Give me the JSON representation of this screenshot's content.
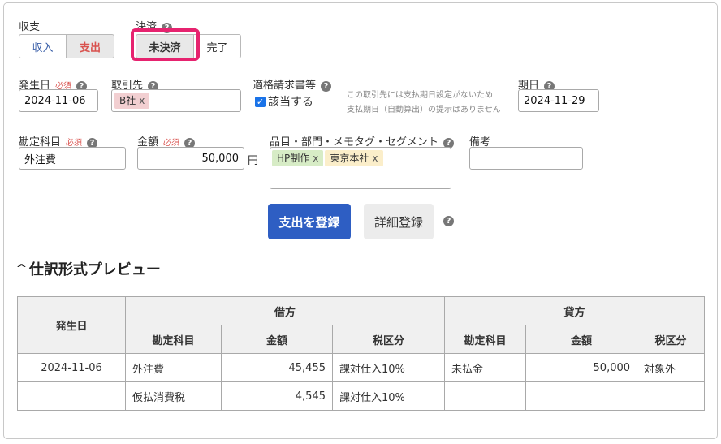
{
  "income_expense": {
    "label": "収支",
    "options": [
      "収入",
      "支出"
    ],
    "selected": "支出",
    "colors": {
      "income": "#3a5fa8",
      "expense": "#d9534f"
    }
  },
  "settlement": {
    "label": "決済",
    "options": [
      "未決済",
      "完了"
    ],
    "selected": "未決済"
  },
  "date": {
    "label": "発生日",
    "required": "必須",
    "value": "2024-11-06"
  },
  "partner": {
    "label": "取引先",
    "tag": "B社",
    "tag_remove": "x",
    "tag_color": "#f2cfd1"
  },
  "invoice": {
    "label": "適格請求書等",
    "checkbox_label": "該当する",
    "checked": true
  },
  "due_note": {
    "line1": "この取引先には支払期日設定がないため",
    "line2": "支払期日（自動算出）の提示はありません"
  },
  "due_date": {
    "label": "期日",
    "value": "2024-11-29"
  },
  "account": {
    "label": "勘定科目",
    "required": "必須",
    "value": "外注費"
  },
  "amount": {
    "label": "金額",
    "required": "必須",
    "value": "50,000",
    "unit": "円"
  },
  "items": {
    "label": "品目・部門・メモタグ・セグメント",
    "tags": [
      {
        "text": "HP制作",
        "remove": "x",
        "color": "#d7ecc6"
      },
      {
        "text": "東京本社",
        "remove": "x",
        "color": "#fbeeca"
      }
    ]
  },
  "memo": {
    "label": "備考",
    "value": ""
  },
  "buttons": {
    "register": "支出を登録",
    "detail": "詳細登録"
  },
  "preview": {
    "title": "仕訳形式プレビュー",
    "headers": {
      "date": "発生日",
      "debit": "借方",
      "credit": "貸方",
      "account": "勘定科目",
      "amount": "金額",
      "tax": "税区分"
    },
    "rows": [
      {
        "date": "2024-11-06",
        "d_account": "外注費",
        "d_amount": "45,455",
        "d_tax": "課対仕入10%",
        "c_account": "未払金",
        "c_amount": "50,000",
        "c_tax": "対象外"
      },
      {
        "date": "",
        "d_account": "仮払消費税",
        "d_amount": "4,545",
        "d_tax": "課対仕入10%",
        "c_account": "",
        "c_amount": "",
        "c_tax": ""
      }
    ]
  },
  "theme": {
    "primary": "#2e5ec3",
    "highlight": "#e6236f"
  }
}
